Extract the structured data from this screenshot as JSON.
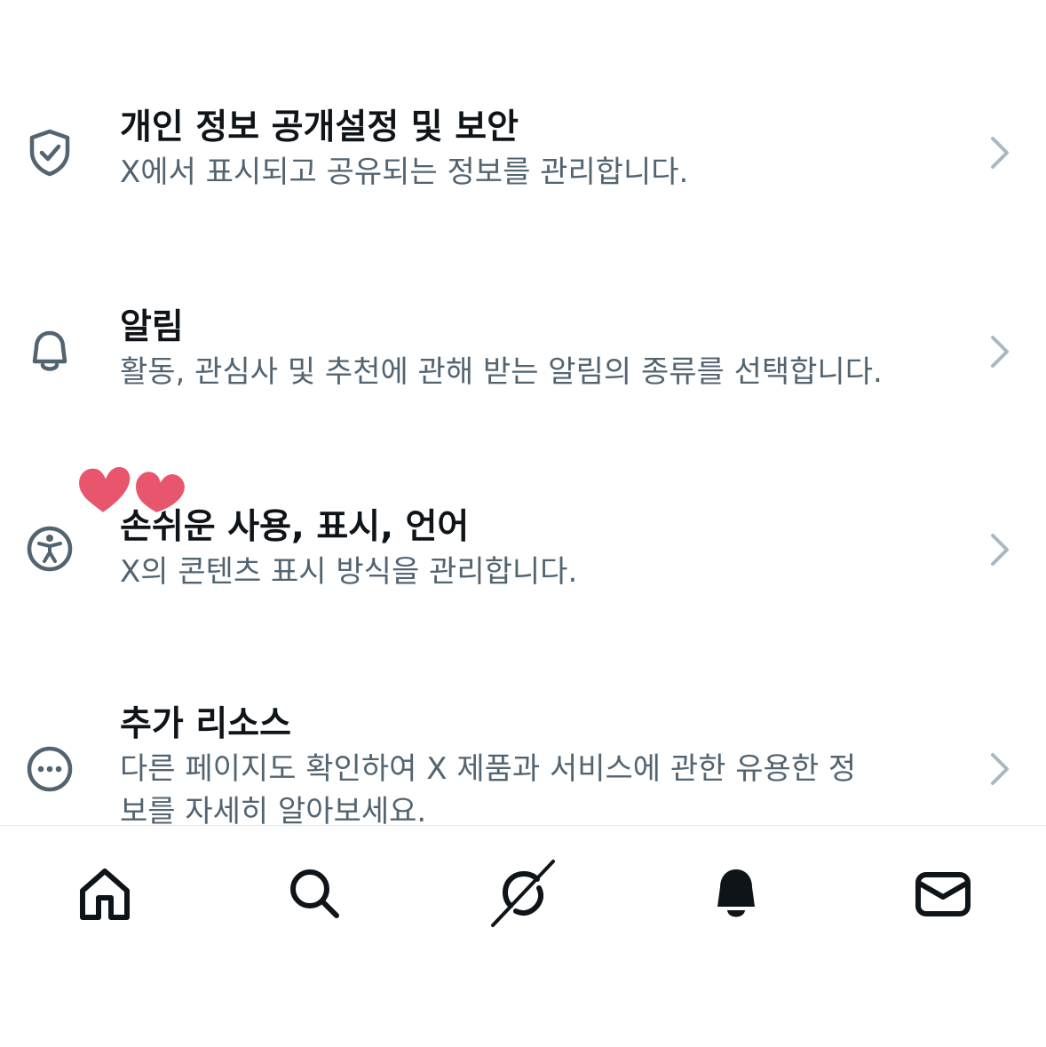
{
  "settings": {
    "items": [
      {
        "icon": "shield-check-icon",
        "title": "개인 정보 공개설정 및 보안",
        "desc": "X에서 표시되고 공유되는 정보를 관리합니다."
      },
      {
        "icon": "bell-icon",
        "title": "알림",
        "desc": "활동, 관심사 및 추천에 관해 받는 알림의 종류를 선택합니다."
      },
      {
        "icon": "accessibility-icon",
        "title": "손쉬운 사용, 표시, 언어",
        "desc": "X의 콘텐츠 표시 방식을 관리합니다."
      },
      {
        "icon": "more-circle-icon",
        "title": "추가 리소스",
        "desc": "다른 페이지도 확인하여 X 제품과 서비스에 관한 유용한 정보를 자세히 알아보세요."
      }
    ]
  },
  "nav": {
    "tabs": [
      "home-icon",
      "search-icon",
      "grok-icon",
      "notifications-bell-icon",
      "messages-envelope-icon"
    ]
  },
  "colors": {
    "title": "#0f1419",
    "secondary": "#536471",
    "chevron": "#aab8c2",
    "divider": "#e4e8eb",
    "heart": "#e8566e"
  }
}
